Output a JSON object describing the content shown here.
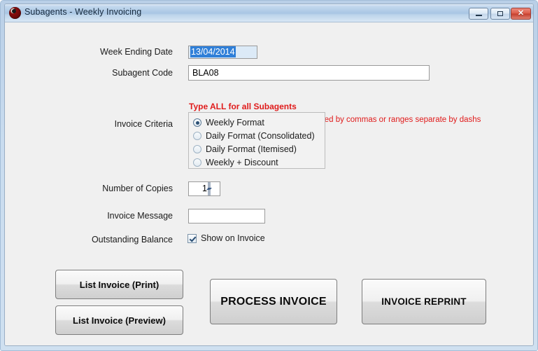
{
  "window": {
    "title": "Subagents - Weekly Invoicing",
    "icon": "app-logo-icon",
    "controls": {
      "minimize_label": "–",
      "maximize_label": "□",
      "close_label": "✕"
    },
    "colors": {
      "titlebar_blue": "#a8c6e4",
      "frame_blue": "#c9dcef",
      "form_background": "#f0f0f0",
      "close_red": "#c43d2c",
      "warning_red": "#e01b1b",
      "selection_blue": "#2f7fd8",
      "date_field_blue": "#dceaf7"
    }
  },
  "form": {
    "week_ending_date": {
      "label": "Week Ending Date",
      "value": "13/04/2014",
      "selected": true
    },
    "subagent_code": {
      "label": "Subagent Code",
      "value": "BLA08",
      "placeholder": ""
    },
    "notes": {
      "type_all": "Type ALL for all Subagents",
      "range_selection": "Range Selection:  Enter codes separated by commas or ranges separate by dashs"
    },
    "invoice_criteria": {
      "label": "Invoice Criteria",
      "selected": "Weekly Format",
      "options": [
        {
          "label": "Weekly Format",
          "checked": true
        },
        {
          "label": "Daily Format (Consolidated)",
          "checked": false
        },
        {
          "label": "Daily Format (Itemised)",
          "checked": false
        },
        {
          "label": "Weekly + Discount",
          "checked": false
        }
      ]
    },
    "number_of_copies": {
      "label": "Number of Copies",
      "value": "1"
    },
    "invoice_message": {
      "label": "Invoice Message",
      "value": "",
      "placeholder": ""
    },
    "outstanding_balance": {
      "label": "Outstanding Balance",
      "checkbox_label": "Show on Invoice",
      "checked": true
    }
  },
  "actions": {
    "list_invoice_print": "List Invoice (Print)",
    "list_invoice_preview": "List Invoice (Preview)",
    "process_invoice": "PROCESS INVOICE",
    "invoice_reprint": "INVOICE REPRINT"
  }
}
